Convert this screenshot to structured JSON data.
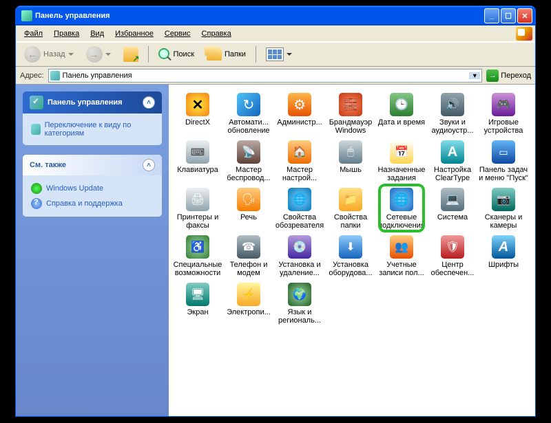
{
  "titlebar": {
    "title": "Панель управления"
  },
  "menu": {
    "file": "Файл",
    "edit": "Правка",
    "view": "Вид",
    "favorites": "Избранное",
    "tools": "Сервис",
    "help": "Справка"
  },
  "toolbar": {
    "back": "Назад",
    "search": "Поиск",
    "folders": "Папки"
  },
  "address": {
    "label": "Адрес:",
    "value": "Панель управления",
    "go": "Переход"
  },
  "sidebar": {
    "panel1": {
      "title": "Панель управления",
      "switch": "Переключение к виду по категориям"
    },
    "panel2": {
      "title": "См. также",
      "links": [
        {
          "label": "Windows Update"
        },
        {
          "label": "Справка и поддержка"
        }
      ]
    }
  },
  "items": [
    {
      "label": "DirectX"
    },
    {
      "label": "Автомати... обновление"
    },
    {
      "label": "Администр..."
    },
    {
      "label": "Брандмауэр Windows"
    },
    {
      "label": "Дата и время"
    },
    {
      "label": "Звуки и аудиоустр..."
    },
    {
      "label": "Игровые устройства"
    },
    {
      "label": "Клавиатура"
    },
    {
      "label": "Мастер беспровод..."
    },
    {
      "label": "Мастер настрой..."
    },
    {
      "label": "Мышь"
    },
    {
      "label": "Назначенные задания"
    },
    {
      "label": "Настройка ClearType"
    },
    {
      "label": "Панель задач и меню \"Пуск\""
    },
    {
      "label": "Принтеры и факсы"
    },
    {
      "label": "Речь"
    },
    {
      "label": "Свойства обозревателя"
    },
    {
      "label": "Свойства папки"
    },
    {
      "label": "Сетевые подключения",
      "highlight": true
    },
    {
      "label": "Система"
    },
    {
      "label": "Сканеры и камеры"
    },
    {
      "label": "Специальные возможности"
    },
    {
      "label": "Телефон и модем"
    },
    {
      "label": "Установка и удаление..."
    },
    {
      "label": "Установка оборудова..."
    },
    {
      "label": "Учетные записи пол..."
    },
    {
      "label": "Центр обеспечен..."
    },
    {
      "label": "Шрифты"
    },
    {
      "label": "Экран"
    },
    {
      "label": "Электропи..."
    },
    {
      "label": "Язык и региональ..."
    }
  ]
}
